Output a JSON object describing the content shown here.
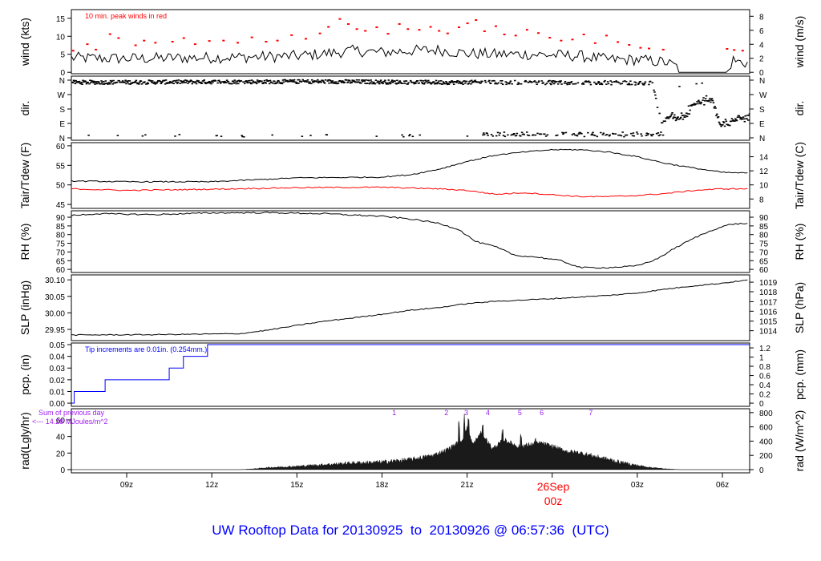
{
  "chart_data": {
    "type": "line",
    "title": "UW Rooftop Data for 20130925  to  20130926 @ 06:57:36  (UTC)",
    "x_unit": "hours UTC since 2013-09-25 00z",
    "xlim": [
      7.05,
      30.96
    ],
    "x_ticks": [
      {
        "h": 9,
        "label": "09z"
      },
      {
        "h": 12,
        "label": "12z"
      },
      {
        "h": 15,
        "label": "15z"
      },
      {
        "h": 18,
        "label": "18z"
      },
      {
        "h": 21,
        "label": "21z"
      },
      {
        "h": 27,
        "label": "03z"
      },
      {
        "h": 30,
        "label": "06z"
      }
    ],
    "day_marker": {
      "h": 24,
      "date": "26Sep",
      "label": "00z",
      "color": "#ff0000"
    },
    "panels": [
      {
        "key": "wind",
        "ylabel": "wind (kts)",
        "ylabel_right": "wind (m/s)",
        "ylim": [
          -0.4,
          17.4
        ],
        "left_ticks": [
          0,
          5,
          10,
          15
        ],
        "right_ticks": [
          {
            "v": 0,
            "label": "0"
          },
          {
            "v": 3.888,
            "label": "2"
          },
          {
            "v": 7.776,
            "label": "4"
          },
          {
            "v": 11.664,
            "label": "6"
          },
          {
            "v": 15.552,
            "label": "8"
          }
        ],
        "annotation": "10 min. peak winds in red",
        "annotation_color": "#ff0000",
        "series": [
          {
            "name": "wind",
            "color": "#000000",
            "noise": 1.6,
            "x": [
              7.05,
              9,
              11,
              13,
              15,
              16,
              17,
              18,
              19,
              20,
              21,
              22,
              23,
              24,
              25,
              26,
              27,
              28,
              28.4,
              28.5,
              30.2,
              30.35,
              30.5,
              30.96
            ],
            "y": [
              4,
              3.8,
              4,
              4.2,
              4.5,
              5.2,
              6,
              5.5,
              6,
              6.2,
              5.2,
              5,
              5,
              4.8,
              4.5,
              3.5,
              3.5,
              2.8,
              1.5,
              0,
              0,
              3.5,
              3,
              2.5
            ]
          }
        ],
        "peaks": {
          "color": "#ff0000",
          "x": [
            7.1,
            7.6,
            7.9,
            8.4,
            8.7,
            9.3,
            9.6,
            10.0,
            10.6,
            11.0,
            11.4,
            11.9,
            12.4,
            12.9,
            13.4,
            13.9,
            14.3,
            14.8,
            15.3,
            15.8,
            16.1,
            16.5,
            16.8,
            17.1,
            17.4,
            17.8,
            18.2,
            18.6,
            18.9,
            19.3,
            19.7,
            20.0,
            20.3,
            20.7,
            21.0,
            21.3,
            21.6,
            22.0,
            22.3,
            22.7,
            23.1,
            23.5,
            23.9,
            24.3,
            24.7,
            25.1,
            25.5,
            25.9,
            26.3,
            26.7,
            27.1,
            27.4,
            27.9,
            30.15,
            30.4,
            30.7
          ],
          "y": [
            6,
            7.8,
            6.3,
            10.6,
            9.5,
            7.5,
            8.8,
            8.2,
            8.5,
            9.5,
            7.8,
            8.7,
            8.8,
            8.2,
            9.7,
            8.5,
            8.8,
            10.3,
            9.3,
            10.8,
            12.6,
            14.8,
            13.4,
            12,
            11.5,
            12.5,
            10.7,
            13.4,
            12,
            11.8,
            12.6,
            11.5,
            10.8,
            12.5,
            13.6,
            14.5,
            11.4,
            12.8,
            10.5,
            10.2,
            11.8,
            10.9,
            9.6,
            8.8,
            9.1,
            10.5,
            8.1,
            10.2,
            8.4,
            7.6,
            6.8,
            6.6,
            6.3,
            6.5,
            6.2,
            6.0
          ]
        }
      },
      {
        "key": "dir",
        "ylabel": "dir.",
        "ylabel_right": "dir.",
        "ylim": [
          -15,
          385
        ],
        "left_ticks": [
          {
            "v": 0,
            "label": "N"
          },
          {
            "v": 90,
            "label": "E"
          },
          {
            "v": 180,
            "label": "S"
          },
          {
            "v": 270,
            "label": "W"
          },
          {
            "v": 360,
            "label": "N"
          }
        ],
        "right_ticks": [
          {
            "v": 0,
            "label": "N"
          },
          {
            "v": 90,
            "label": "E"
          },
          {
            "v": 180,
            "label": "S"
          },
          {
            "v": 270,
            "label": "W"
          },
          {
            "v": 360,
            "label": "N"
          }
        ],
        "series": [
          {
            "name": "direction",
            "color": "#000000",
            "style": "dots",
            "x": [
              7.05,
              12,
              16,
              20,
              22,
              24,
              26,
              27.5,
              27.8,
              28.2,
              28.6,
              29,
              29.3,
              29.6,
              29.9,
              30.2,
              30.5,
              30.96
            ],
            "y": [
              345,
              348,
              350,
              345,
              345,
              344,
              343,
              340,
              100,
              130,
              110,
              220,
              225,
              235,
              80,
              85,
              120,
              130
            ]
          }
        ]
      },
      {
        "key": "temp",
        "ylabel": "Tair/Tdew (F)",
        "ylabel_right": "Tair/Tdew (C)",
        "ylim": [
          44,
          60.8
        ],
        "left_ticks": [
          45,
          50,
          55,
          60
        ],
        "right_ticks": [
          {
            "v": 46.4,
            "label": "8"
          },
          {
            "v": 50,
            "label": "10"
          },
          {
            "v": 53.6,
            "label": "12"
          },
          {
            "v": 57.2,
            "label": "14"
          }
        ],
        "series": [
          {
            "name": "Tair",
            "color": "#000000",
            "noise": 0.15,
            "x": [
              7.05,
              9,
              12,
              15,
              18,
              19,
              20,
              21,
              22,
              23,
              24,
              25,
              26,
              27,
              28,
              29,
              30,
              30.96
            ],
            "y": [
              51,
              50.8,
              50.8,
              51.8,
              52,
              52.6,
              54,
              56,
              57.6,
              58.4,
              59,
              59,
              58.4,
              57.2,
              55.5,
              54.3,
              53.2,
              53
            ]
          },
          {
            "name": "Tdew",
            "color": "#ff0000",
            "noise": 0.15,
            "x": [
              7.05,
              9,
              12,
              15,
              18,
              20,
              21,
              22,
              23,
              24,
              25,
              26,
              27,
              28,
              29,
              30,
              30.96
            ],
            "y": [
              49,
              48.6,
              48.9,
              49.3,
              49.4,
              49,
              48.6,
              47.6,
              48,
              47.5,
              47,
              47,
              47.3,
              47.8,
              48.6,
              49,
              49
            ]
          }
        ]
      },
      {
        "key": "rh",
        "ylabel": "RH (%)",
        "ylabel_right": "RH (%)",
        "ylim": [
          58.2,
          93.7
        ],
        "left_ticks": [
          60,
          65,
          70,
          75,
          80,
          85,
          90
        ],
        "right_ticks": [
          {
            "v": 60,
            "label": "60"
          },
          {
            "v": 65,
            "label": "65"
          },
          {
            "v": 70,
            "label": "70"
          },
          {
            "v": 75,
            "label": "75"
          },
          {
            "v": 80,
            "label": "80"
          },
          {
            "v": 85,
            "label": "85"
          },
          {
            "v": 90,
            "label": "90"
          }
        ],
        "series": [
          {
            "name": "RH",
            "color": "#000000",
            "noise": 0.4,
            "x": [
              7.05,
              8,
              10,
              12,
              14,
              16,
              18,
              19,
              20,
              20.7,
              21.3,
              22,
              22.7,
              23.5,
              24.3,
              25,
              26,
              27,
              27.7,
              28.3,
              29,
              29.7,
              30.3,
              30.96
            ],
            "y": [
              91,
              92,
              91.5,
              92.5,
              92.6,
              92,
              90.5,
              89,
              86.5,
              83,
              76,
              73,
              68,
              67,
              65,
              61,
              61,
              62,
              66,
              72,
              78,
              83,
              86,
              86.5
            ]
          }
        ]
      },
      {
        "key": "slp",
        "ylabel": "SLP (inHg)",
        "ylabel_right": "SLP (hPa)",
        "ylim": [
          29.916,
          30.115
        ],
        "left_ticks": [
          {
            "v": 29.95,
            "label": "29.95"
          },
          {
            "v": 30.0,
            "label": "30.00"
          },
          {
            "v": 30.05,
            "label": "30.05"
          },
          {
            "v": 30.1,
            "label": "30.10"
          }
        ],
        "right_ticks": [
          {
            "v": 29.946,
            "label": "1014"
          },
          {
            "v": 29.975,
            "label": "1015"
          },
          {
            "v": 30.005,
            "label": "1016"
          },
          {
            "v": 30.034,
            "label": "1017"
          },
          {
            "v": 30.064,
            "label": "1018"
          },
          {
            "v": 30.093,
            "label": "1019"
          }
        ],
        "series": [
          {
            "name": "SLP",
            "color": "#000000",
            "noise": 0.0015,
            "x": [
              7.05,
              10,
              13,
              14,
              15,
              16,
              17,
              18,
              19,
              20,
              21,
              22,
              24,
              26,
              27,
              28,
              29,
              30,
              30.96
            ],
            "y": [
              29.933,
              29.934,
              29.937,
              29.948,
              29.962,
              29.975,
              29.985,
              29.996,
              30.008,
              30.016,
              30.028,
              30.035,
              30.043,
              30.053,
              30.06,
              30.072,
              30.082,
              30.09,
              30.1
            ]
          }
        ]
      },
      {
        "key": "pcp",
        "ylabel": "pcp. (in)",
        "ylabel_right": "pcp. (mm)",
        "ylim": [
          -0.0027,
          0.0514
        ],
        "left_ticks": [
          {
            "v": 0,
            "label": "0.00"
          },
          {
            "v": 0.01,
            "label": "0.01"
          },
          {
            "v": 0.02,
            "label": "0.02"
          },
          {
            "v": 0.03,
            "label": "0.03"
          },
          {
            "v": 0.04,
            "label": "0.04"
          },
          {
            "v": 0.05,
            "label": "0.05"
          }
        ],
        "right_ticks": [
          {
            "v": 0,
            "label": "0"
          },
          {
            "v": 0.00787,
            "label": "0.2"
          },
          {
            "v": 0.01575,
            "label": "0.4"
          },
          {
            "v": 0.02362,
            "label": "0.6"
          },
          {
            "v": 0.0315,
            "label": "0.8"
          },
          {
            "v": 0.03937,
            "label": "1"
          },
          {
            "v": 0.04724,
            "label": "1.2"
          }
        ],
        "annotation": "Tip increments are 0.01in. (0.254mm.)",
        "annotation_color": "#0000ff",
        "series": [
          {
            "name": "precip",
            "color": "#0000ff",
            "style": "step",
            "x": [
              7.05,
              7.15,
              8.24,
              10.5,
              11.0,
              11.85,
              30.96
            ],
            "y": [
              0,
              0.01,
              0.02,
              0.03,
              0.04,
              0.05,
              0.05
            ]
          }
        ]
      },
      {
        "key": "rad",
        "ylabel": "rad(Lgly/hr)",
        "ylabel_right": "rad (W/m^2)",
        "ylim": [
          -3.9,
          73.5
        ],
        "left_ticks": [
          0,
          20,
          40,
          60
        ],
        "right_ticks": [
          {
            "v": 0,
            "label": "0"
          },
          {
            "v": 17.2,
            "label": "200"
          },
          {
            "v": 34.4,
            "label": "400"
          },
          {
            "v": 51.6,
            "label": "600"
          },
          {
            "v": 68.8,
            "label": "800"
          }
        ],
        "annotation_lines": [
          "Sum of previous day",
          "<--- 14.28 MJoules/m^2"
        ],
        "annotation_color": "#a020f0",
        "markers": {
          "color": "#a020f0",
          "x": [
            18.43,
            20.27,
            20.97,
            21.73,
            22.86,
            23.63,
            25.36
          ],
          "labels": [
            "1",
            "2",
            "3",
            "4",
            "5",
            "6",
            "7"
          ]
        },
        "series": [
          {
            "name": "radiation",
            "color": "#000000",
            "style": "area",
            "noise": 3,
            "x": [
              7.05,
              13,
              13.5,
              14,
              15,
              16,
              17,
              18,
              19,
              19.8,
              20.3,
              20.8,
              21.0,
              21.2,
              21.5,
              21.9,
              22.3,
              22.8,
              23.2,
              23.6,
              24,
              24.5,
              25,
              25.5,
              26,
              26.5,
              27,
              27.5,
              28,
              28.5,
              30.96
            ],
            "y": [
              0,
              0,
              1,
              2.5,
              4,
              6,
              8,
              9,
              12,
              17,
              24,
              35,
              50,
              30,
              45,
              25,
              36,
              28,
              30,
              32,
              28,
              22,
              20,
              16,
              12,
              8,
              5,
              2.5,
              1,
              0,
              0
            ],
            "spikes": [
              {
                "x": 20.72,
                "y": 60
              },
              {
                "x": 20.9,
                "y": 68
              },
              {
                "x": 21.05,
                "y": 67
              },
              {
                "x": 21.55,
                "y": 54
              },
              {
                "x": 22.25,
                "y": 50
              },
              {
                "x": 22.9,
                "y": 43
              },
              {
                "x": 23.4,
                "y": 42
              }
            ]
          }
        ]
      }
    ]
  }
}
